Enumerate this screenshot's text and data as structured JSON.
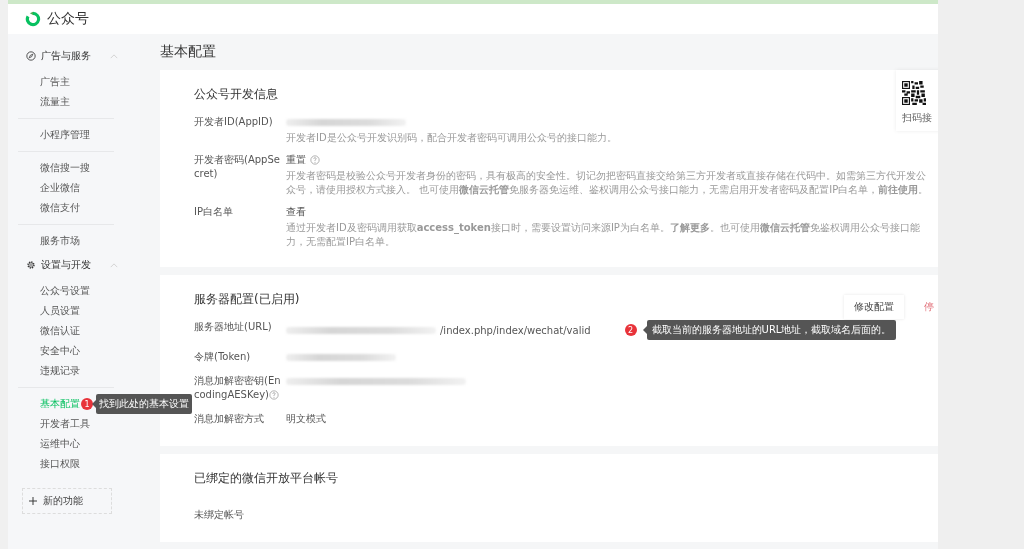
{
  "header": {
    "title": "公众号"
  },
  "sidebar": {
    "groups": [
      {
        "title": "广告与服务",
        "sections": [
          [
            {
              "label": "广告主",
              "selected": false
            },
            {
              "label": "流量主",
              "selected": false
            }
          ],
          [
            {
              "label": "小程序管理",
              "selected": false
            }
          ],
          [
            {
              "label": "微信搜一搜",
              "selected": false
            },
            {
              "label": "企业微信",
              "selected": false
            },
            {
              "label": "微信支付",
              "selected": false
            }
          ],
          [
            {
              "label": "服务市场",
              "selected": false
            }
          ]
        ]
      },
      {
        "title": "设置与开发",
        "sections": [
          [
            {
              "label": "公众号设置",
              "selected": false
            },
            {
              "label": "人员设置",
              "selected": false
            },
            {
              "label": "微信认证",
              "selected": false
            },
            {
              "label": "安全中心",
              "selected": false
            },
            {
              "label": "违规记录",
              "selected": false
            }
          ],
          [
            {
              "label": "基本配置",
              "selected": true,
              "annotation": {
                "number": "1",
                "text": "找到此处的基本设置"
              }
            },
            {
              "label": "开发者工具",
              "selected": false
            },
            {
              "label": "运维中心",
              "selected": false
            },
            {
              "label": "接口权限",
              "selected": false
            }
          ]
        ]
      }
    ],
    "new_feature": "新的功能"
  },
  "page_title": "基本配置",
  "dev_info": {
    "title": "公众号开发信息",
    "qr_caption": "扫码接",
    "rows": [
      {
        "label": "开发者ID(AppID)",
        "kind": "redacted",
        "description": "开发者ID是公众号开发识别码，配合开发者密码可调用公众号的接口能力。"
      },
      {
        "label": "开发者密码(AppSecret)",
        "kind": "action",
        "action": "重置",
        "help": true,
        "description": "开发者密码是校验公众号开发者身份的密码，具有极高的安全性。切记勿把密码直接交给第三方开发者或直接存储在代码中。如需第三方代开发公众号，请使用授权方式接入。 也可使用**微信云托管**免服务器免运维、鉴权调用公众号接口能力，无需启用开发者密码及配置IP白名单，**前往使用**。"
      },
      {
        "label": "IP白名单",
        "kind": "action",
        "action": "查看",
        "help": false,
        "description": "通过开发者ID及密码调用获取**access_token**接口时，需要设置访问来源IP为白名单。**了解更多**。也可使用**微信云托管**免鉴权调用公众号接口能力，无需配置IP白名单。"
      }
    ]
  },
  "server_config": {
    "title": "服务器配置(已启用)",
    "buttons": [
      {
        "label": "修改配置",
        "kind": "default"
      },
      {
        "label": "停",
        "kind": "danger"
      }
    ],
    "rows": [
      {
        "label": "服务器地址(URL)",
        "kind": "redacted",
        "value": "/index.php/index/wechat/valid",
        "annotation": {
          "number": "2",
          "text": "截取当前的服务器地址的URL地址，截取域名后面的。"
        }
      },
      {
        "label": "令牌(Token)",
        "kind": "redacted"
      },
      {
        "label": "消息加解密密钥(EncodingAESKey)",
        "kind": "redacted",
        "help": true
      },
      {
        "label": "消息加解密方式",
        "kind": "text",
        "value": "明文模式"
      }
    ]
  },
  "open_platform": {
    "title": "已绑定的微信开放平台帐号",
    "note": "未绑定帐号"
  }
}
